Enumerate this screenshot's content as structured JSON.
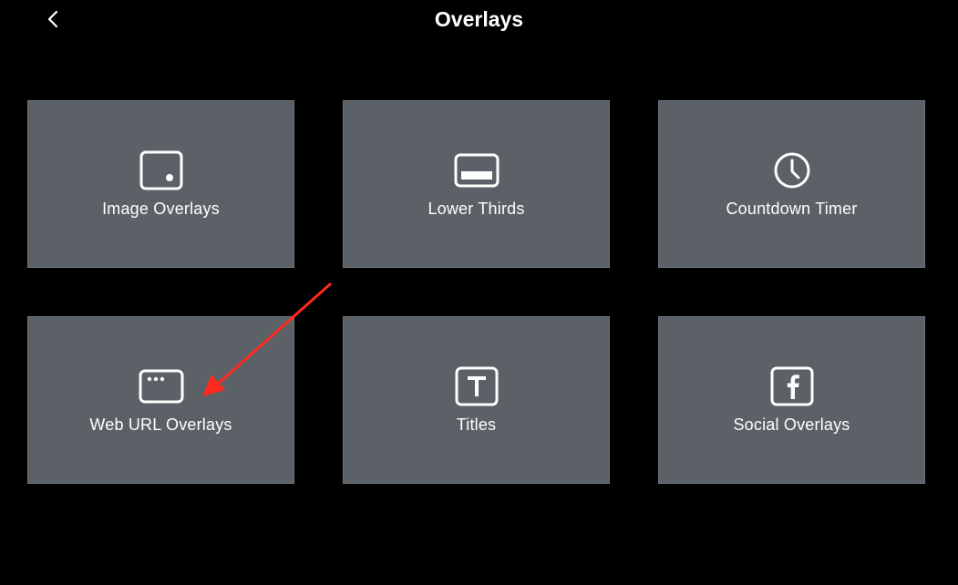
{
  "header": {
    "title": "Overlays",
    "back_icon": "chevron-left-icon"
  },
  "theme": {
    "background": "#000000",
    "tile_background": "#5b6167",
    "text": "#ffffff",
    "annotation_arrow": "#ff2a1f"
  },
  "tiles": [
    {
      "label": "Image Overlays",
      "icon": "image-frame-icon"
    },
    {
      "label": "Lower Thirds",
      "icon": "lower-thirds-icon"
    },
    {
      "label": "Countdown Timer",
      "icon": "clock-icon"
    },
    {
      "label": "Web URL Overlays",
      "icon": "browser-window-icon"
    },
    {
      "label": "Titles",
      "icon": "text-t-icon"
    },
    {
      "label": "Social Overlays",
      "icon": "facebook-icon"
    }
  ]
}
